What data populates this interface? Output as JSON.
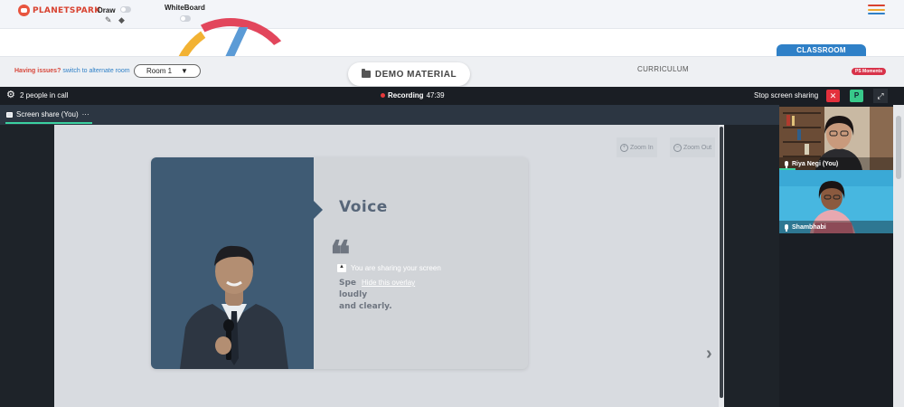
{
  "brand": {
    "logo_text": "PLANETSPARK"
  },
  "toolbar": {
    "draw_label": "Draw",
    "whiteboard_label": "WhiteBoard",
    "draw_on": false,
    "whiteboard_on": false
  },
  "room_bar": {
    "issues_label": "Having issues?",
    "switch_label": "switch to alternate room",
    "room_selected": "Room 1",
    "demo_material_label": "DEMO MATERIAL",
    "curriculum_label": "CURRICULUM",
    "classroom_tab": "CLASSROOM",
    "ps_moments": "PS Moments"
  },
  "call": {
    "people_count": "2 people in call",
    "recording_label": "Recording",
    "recording_time": "47:39",
    "stop_share_label": "Stop screen sharing",
    "close_symbol": "✕",
    "p_button": "P",
    "tab_label": "Screen share (You)",
    "tab_more": "···"
  },
  "shared_screen": {
    "zoom_in": "Zoom In",
    "zoom_out": "Zoom Out",
    "slide_title": "Voice",
    "quote_mark": "❝",
    "slide_text_line1": "Spe",
    "slide_text_line1_end": "loudly",
    "slide_text_line2": "and clearly.",
    "overlay_message": "You are sharing your screen",
    "hide_overlay": "Hide this overlay"
  },
  "participants": [
    {
      "name": "Riya Negi (You)"
    },
    {
      "name": "Shambhabi"
    }
  ],
  "colors": {
    "brand_red": "#d8412f",
    "accent_blue": "#2f80c7",
    "recording_red": "#e5393b",
    "green": "#38c98a"
  }
}
